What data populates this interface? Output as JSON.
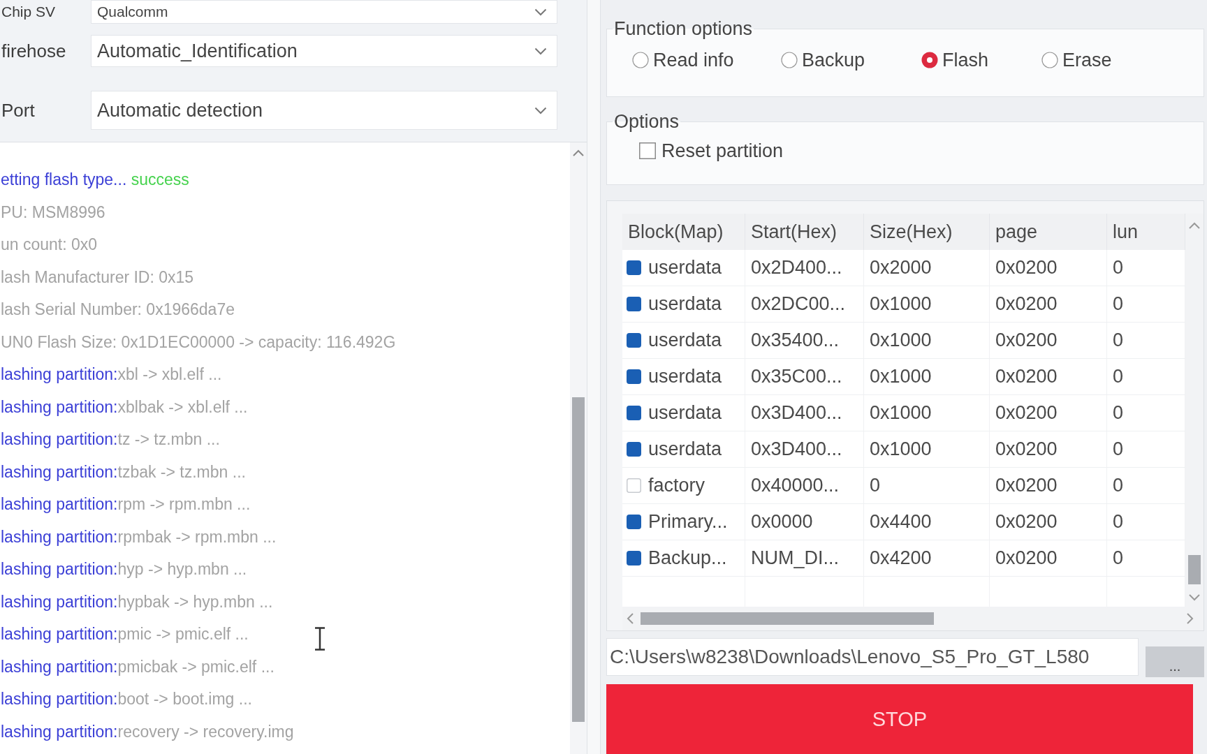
{
  "device": {
    "fields": [
      {
        "label": "Chip SV",
        "value": "Qualcomm"
      },
      {
        "label": "firehose",
        "value": "Automatic_Identification"
      },
      {
        "label": "Port",
        "value": "Automatic detection"
      }
    ]
  },
  "log": {
    "lines": [
      {
        "parts": [
          {
            "kind": "label",
            "text": "etting flash type..."
          },
          {
            "kind": "status",
            "text": "success"
          }
        ]
      },
      {
        "parts": [
          {
            "kind": "value",
            "text": "PU: MSM8996"
          }
        ]
      },
      {
        "parts": [
          {
            "kind": "value",
            "text": "un count: 0x0"
          }
        ]
      },
      {
        "parts": [
          {
            "kind": "value",
            "text": "lash Manufacturer ID: 0x15"
          }
        ]
      },
      {
        "parts": [
          {
            "kind": "value",
            "text": "lash Serial Number: 0x1966da7e"
          }
        ]
      },
      {
        "parts": [
          {
            "kind": "value",
            "text": "UN0 Flash Size: 0x1D1EC00000 -> capacity: 116.492G"
          }
        ]
      },
      {
        "parts": [
          {
            "kind": "label",
            "text": "lashing partition:"
          },
          {
            "kind": "value",
            "text": "xbl -> xbl.elf ..."
          }
        ]
      },
      {
        "parts": [
          {
            "kind": "label",
            "text": "lashing partition:"
          },
          {
            "kind": "value",
            "text": "xblbak -> xbl.elf ..."
          }
        ]
      },
      {
        "parts": [
          {
            "kind": "label",
            "text": "lashing partition:"
          },
          {
            "kind": "value",
            "text": "tz -> tz.mbn ..."
          }
        ]
      },
      {
        "parts": [
          {
            "kind": "label",
            "text": "lashing partition:"
          },
          {
            "kind": "value",
            "text": "tzbak -> tz.mbn ..."
          }
        ]
      },
      {
        "parts": [
          {
            "kind": "label",
            "text": "lashing partition:"
          },
          {
            "kind": "value",
            "text": "rpm -> rpm.mbn ..."
          }
        ]
      },
      {
        "parts": [
          {
            "kind": "label",
            "text": "lashing partition:"
          },
          {
            "kind": "value",
            "text": "rpmbak -> rpm.mbn ..."
          }
        ]
      },
      {
        "parts": [
          {
            "kind": "label",
            "text": "lashing partition:"
          },
          {
            "kind": "value",
            "text": "hyp -> hyp.mbn ..."
          }
        ]
      },
      {
        "parts": [
          {
            "kind": "label",
            "text": "lashing partition:"
          },
          {
            "kind": "value",
            "text": "hypbak -> hyp.mbn ..."
          }
        ]
      },
      {
        "parts": [
          {
            "kind": "label",
            "text": "lashing partition:"
          },
          {
            "kind": "value",
            "text": "pmic -> pmic.elf ..."
          }
        ]
      },
      {
        "parts": [
          {
            "kind": "label",
            "text": "lashing partition:"
          },
          {
            "kind": "value",
            "text": "pmicbak -> pmic.elf ..."
          }
        ]
      },
      {
        "parts": [
          {
            "kind": "label",
            "text": "lashing partition:"
          },
          {
            "kind": "value",
            "text": "boot -> boot.img ..."
          }
        ]
      },
      {
        "parts": [
          {
            "kind": "label",
            "text": "lashing partition:"
          },
          {
            "kind": "value",
            "text": "recovery -> recovery.img"
          }
        ]
      }
    ]
  },
  "function_options": {
    "title": "Function options",
    "choices": [
      {
        "label": "Read info",
        "selected": false
      },
      {
        "label": "Backup",
        "selected": false
      },
      {
        "label": "Flash",
        "selected": true
      },
      {
        "label": "Erase",
        "selected": false
      }
    ]
  },
  "options": {
    "title": "Options",
    "items": [
      {
        "label": "Reset partition",
        "checked": false
      }
    ]
  },
  "partition_table": {
    "columns": [
      "Block(Map)",
      "Start(Hex)",
      "Size(Hex)",
      "page",
      "lun"
    ],
    "rows": [
      {
        "checked": true,
        "cells": [
          "userdata",
          "0x2D400...",
          "0x2000",
          "0x0200",
          "0"
        ]
      },
      {
        "checked": true,
        "cells": [
          "userdata",
          "0x2DC00...",
          "0x1000",
          "0x0200",
          "0"
        ]
      },
      {
        "checked": true,
        "cells": [
          "userdata",
          "0x35400...",
          "0x1000",
          "0x0200",
          "0"
        ]
      },
      {
        "checked": true,
        "cells": [
          "userdata",
          "0x35C00...",
          "0x1000",
          "0x0200",
          "0"
        ]
      },
      {
        "checked": true,
        "cells": [
          "userdata",
          "0x3D400...",
          "0x1000",
          "0x0200",
          "0"
        ]
      },
      {
        "checked": true,
        "cells": [
          "userdata",
          "0x3D400...",
          "0x1000",
          "0x0200",
          "0"
        ]
      },
      {
        "checked": false,
        "cells": [
          "factory",
          "0x40000...",
          "0",
          "0x0200",
          "0"
        ]
      },
      {
        "checked": true,
        "cells": [
          "Primary...",
          "0x0000",
          "0x4400",
          "0x0200",
          "0"
        ]
      },
      {
        "checked": true,
        "cells": [
          "Backup...",
          "NUM_DI...",
          "0x4200",
          "0x0200",
          "0"
        ]
      }
    ]
  },
  "path_field": {
    "value": "C:\\Users\\w8238\\Downloads\\Lenovo_S5_Pro_GT_L580"
  },
  "browse_button": {
    "label": "..."
  },
  "stop_button": {
    "label": "STOP"
  }
}
